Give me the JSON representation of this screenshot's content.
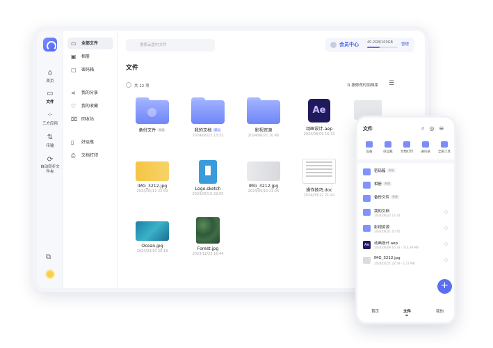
{
  "rail": {
    "items": [
      {
        "label": "首页",
        "icon": "home-icon"
      },
      {
        "label": "文件",
        "icon": "folder-icon"
      },
      {
        "label": "三方应用",
        "icon": "apps-icon"
      },
      {
        "label": "传输",
        "icon": "transfer-icon"
      },
      {
        "label": "自动同步文件夹",
        "icon": "sync-icon"
      }
    ]
  },
  "sidebar": {
    "items": [
      {
        "label": "全部文件"
      },
      {
        "label": "相册"
      },
      {
        "label": "密码箱"
      },
      {
        "label": "我的分享"
      },
      {
        "label": "我的收藏"
      },
      {
        "label": "回收站"
      },
      {
        "label": "好运瓶"
      },
      {
        "label": "文档打印"
      }
    ]
  },
  "header": {
    "search_placeholder": "搜索云盘内文件",
    "member_label": "会员中心",
    "quota": "40.2GB/100GB",
    "quota_fraction": 0.402,
    "manage": "管理"
  },
  "main": {
    "title": "文件",
    "count": "共 12 项",
    "sort": "按修改时间排序"
  },
  "files": [
    {
      "name": "备份文件",
      "tag": "系统",
      "date": ""
    },
    {
      "name": "我的文档",
      "tag": "默认",
      "date": "2024/06/22 13:32"
    },
    {
      "name": "影视资源",
      "tag": "",
      "date": "2024/06/21 10:45"
    },
    {
      "name": "动画设计.aep",
      "tag": "",
      "date": "2024/06/09 16:33"
    },
    {
      "name": "IMG_3212.jpg",
      "tag": "",
      "date": "2024/05/11 22:59"
    },
    {
      "name": "Logo.sketch",
      "tag": "",
      "date": "2024/05/10 23:05"
    },
    {
      "name": "IMG_3212.jpg",
      "tag": "",
      "date": "2024/05/10 23:05"
    },
    {
      "name": "操作技巧.doc",
      "tag": "",
      "date": "2024/03/12 21:42"
    },
    {
      "name": "Ocean.jpg",
      "tag": "",
      "date": "2024/03/10 20:18"
    },
    {
      "name": "Forest.jpg",
      "tag": "",
      "date": "2023/12/23 16:44"
    }
  ],
  "phone": {
    "title": "文件",
    "quick": [
      "设备",
      "好运瓶",
      "文档打印",
      "通讯录",
      "全部工具"
    ],
    "rows": [
      {
        "name": "密码箱",
        "tag": "系统",
        "date": ""
      },
      {
        "name": "相册",
        "tag": "系统",
        "date": ""
      },
      {
        "name": "备份文件",
        "tag": "系统",
        "date": ""
      },
      {
        "name": "我的文档",
        "tag": "",
        "date": "2024/06/22 13:32"
      },
      {
        "name": "影视资源",
        "tag": "",
        "date": "2024/06/21 10:45"
      },
      {
        "name": "动画设计.aep",
        "tag": "",
        "date": "2024/06/09 16:33 · 713.29 MB"
      },
      {
        "name": "IMG_3212.jpg",
        "tag": "",
        "date": "2024/05/11 22:59 · 1.27 MB"
      }
    ],
    "tabs": [
      "首页",
      "文件",
      "我的"
    ]
  },
  "colors": {
    "accent": "#5a6ff0",
    "folder": "#7f93ff"
  }
}
